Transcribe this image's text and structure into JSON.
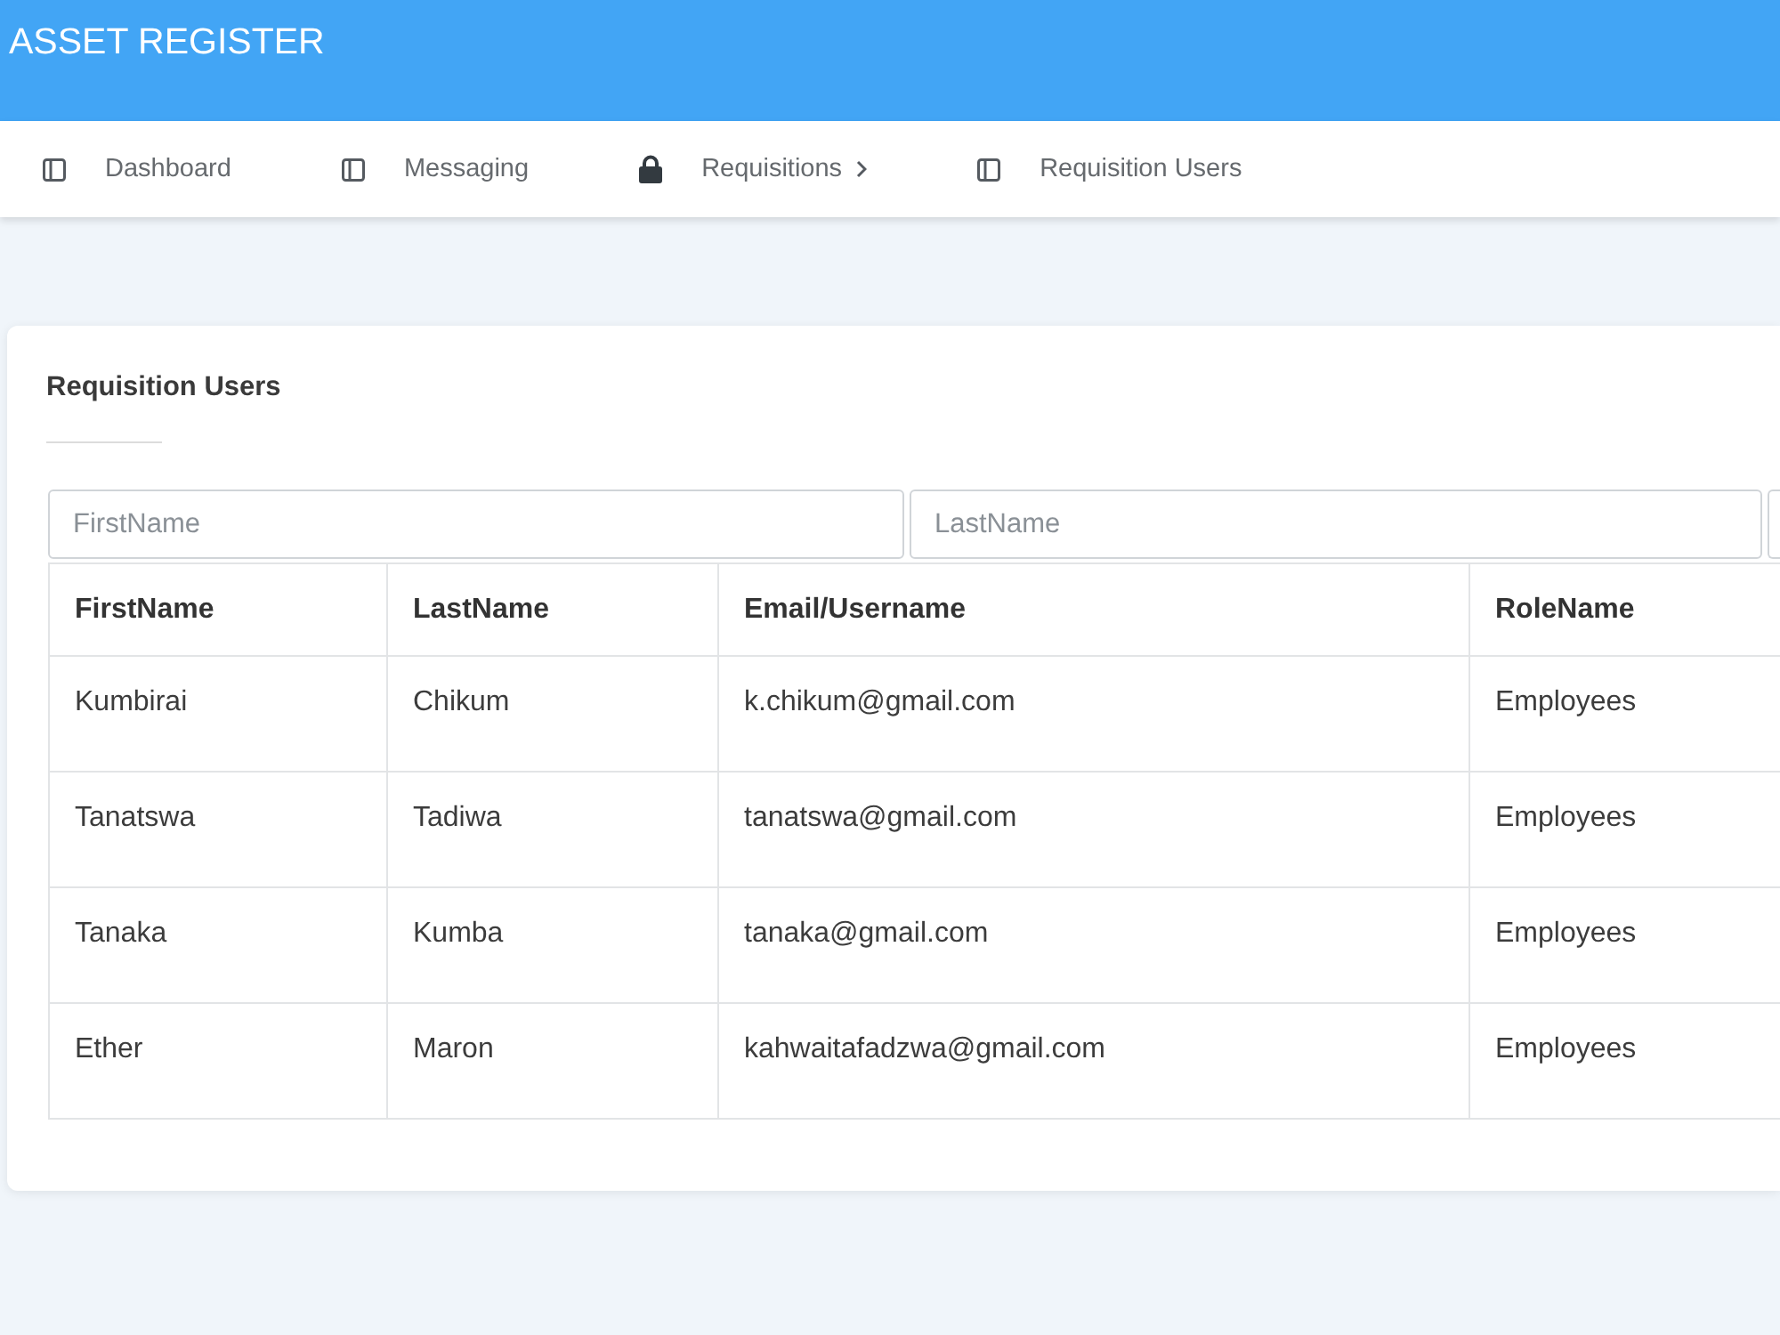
{
  "app_bar": {
    "title": "ASSET REGISTER"
  },
  "nav": {
    "items": [
      {
        "label": "Dashboard",
        "kind": "page"
      },
      {
        "label": "Messaging",
        "kind": "page"
      },
      {
        "label": "Requisitions",
        "kind": "menu"
      },
      {
        "label": "Requisition Users",
        "kind": "page"
      }
    ]
  },
  "card": {
    "title": "Requisition Users",
    "filters": [
      {
        "kind": "text",
        "placeholder": "FirstName"
      },
      {
        "kind": "text",
        "placeholder": "LastName"
      },
      {
        "kind": "text"
      }
    ],
    "table": {
      "columns": [
        "FirstName",
        "LastName",
        "Email/Username",
        "RoleName"
      ],
      "rows": [
        [
          "Kumbirai",
          "Chikum",
          "k.chikum@gmail.com",
          "Employees"
        ],
        [
          "Tanatswa",
          "Tadiwa",
          "tanatswa@gmail.com",
          "Employees"
        ],
        [
          "Tanaka",
          "Kumba",
          "tanaka@gmail.com",
          "Employees"
        ],
        [
          "Ether",
          "Maron",
          "kahwaitafadzwa@gmail.com",
          "Employees"
        ]
      ]
    }
  }
}
